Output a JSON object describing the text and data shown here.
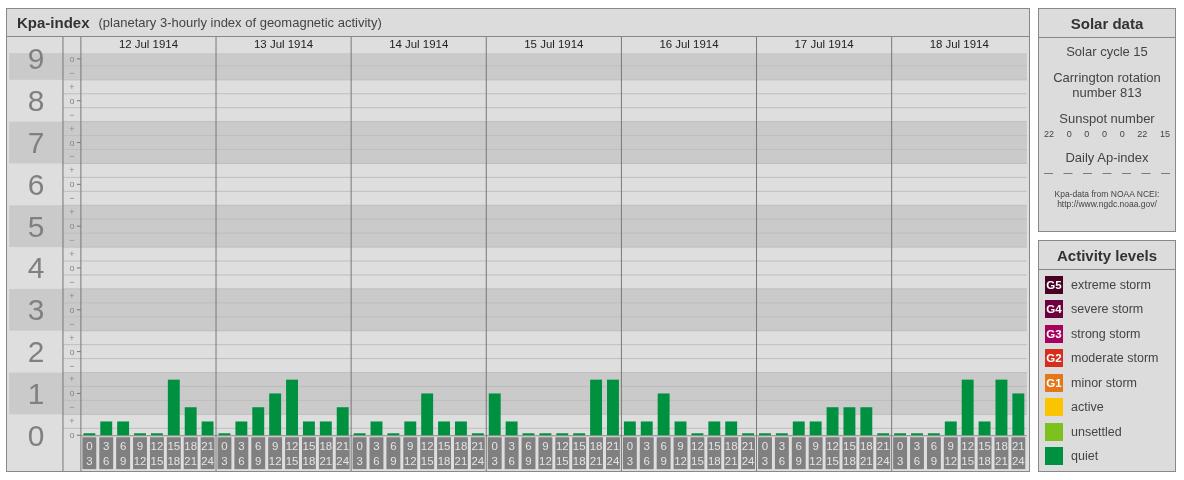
{
  "kp_panel": {
    "title": "Kpa-index",
    "subtitle": "(planetary 3-hourly index of geomagnetic activity)",
    "days": [
      "12 Jul 1914",
      "13 Jul 1914",
      "14 Jul 1914",
      "15 Jul 1914",
      "16 Jul 1914",
      "17 Jul 1914",
      "18 Jul 1914"
    ],
    "chart_data": {
      "type": "bar",
      "categories": [
        "0 3",
        "3 6",
        "6 9",
        "9 12",
        "12 15",
        "15 18",
        "18 21",
        "21 24",
        "0 3",
        "3 6",
        "6 9",
        "9 12",
        "12 15",
        "15 18",
        "18 21",
        "21 24",
        "0 3",
        "3 6",
        "6 9",
        "9 12",
        "12 15",
        "15 18",
        "18 21",
        "21 24",
        "0 3",
        "3 6",
        "6 9",
        "9 12",
        "12 15",
        "15 18",
        "18 21",
        "21 24",
        "0 3",
        "3 6",
        "6 9",
        "9 12",
        "12 15",
        "15 18",
        "18 21",
        "21 24",
        "0 3",
        "3 6",
        "6 9",
        "9 12",
        "12 15",
        "15 18",
        "18 21",
        "21 24",
        "0 3",
        "3 6",
        "6 9",
        "9 12",
        "12 15",
        "15 18",
        "18 21",
        "21 24"
      ],
      "series": [
        {
          "color": "#009140",
          "values": [
            0,
            0.33,
            0.33,
            0,
            0,
            1.33,
            0.67,
            0.33,
            0,
            0.33,
            0.67,
            1,
            1.33,
            0.33,
            0.33,
            0.67,
            0,
            0.33,
            0,
            0.33,
            1,
            0.33,
            0.33,
            0,
            1,
            0.33,
            0,
            0,
            0,
            0,
            1.33,
            1.33,
            0.33,
            0.33,
            1,
            0.33,
            0,
            0.33,
            0.33,
            0,
            0,
            0,
            0.33,
            0.33,
            0.67,
            0.67,
            0.67,
            0,
            0,
            0,
            0,
            0.33,
            1.33,
            0.33,
            1.33,
            1
          ]
        }
      ],
      "ylim": [
        0,
        9.14
      ],
      "yticks": [
        {
          "value": 0,
          "label": "0"
        },
        {
          "value": 1,
          "label": "1"
        },
        {
          "value": 2,
          "label": "2"
        },
        {
          "value": 3,
          "label": "3"
        },
        {
          "value": 4,
          "label": "4"
        },
        {
          "value": 5,
          "label": "5"
        },
        {
          "value": 6,
          "label": "6"
        },
        {
          "value": 7,
          "label": "7"
        },
        {
          "value": 8,
          "label": "8"
        },
        {
          "value": 9,
          "label": "9"
        }
      ],
      "grid": true
    },
    "sublevel_marks": [
      "o",
      "−",
      "+",
      "o",
      "−",
      "+",
      "o",
      "−",
      "+",
      "o",
      "−",
      "+",
      "o",
      "−",
      "+",
      "o",
      "−",
      "+",
      "o",
      "−",
      "+",
      "o",
      "−",
      "+",
      "o",
      "−",
      "+",
      "o"
    ]
  },
  "solar_data": {
    "title": "Solar data",
    "solar_cycle": "Solar cycle 15",
    "carrington": "Carrington rotation number 813",
    "sunspot_heading": "Sunspot number",
    "sunspot_numbers": [
      "22",
      "0",
      "0",
      "0",
      "0",
      "22",
      "15"
    ],
    "ap_heading": "Daily Ap-index",
    "ap_values": [
      "—",
      "—",
      "—",
      "—",
      "—",
      "—",
      "—"
    ],
    "source": [
      "Kpa-data from NOAA NCEI:",
      "http://www.ngdc.noaa.gov/"
    ]
  },
  "activity_levels": {
    "title": "Activity levels",
    "levels": [
      {
        "badge": "G5",
        "label": "extreme storm",
        "color": "#4a0025"
      },
      {
        "badge": "G4",
        "label": "severe storm",
        "color": "#6e0040"
      },
      {
        "badge": "G3",
        "label": "strong storm",
        "color": "#a8005e"
      },
      {
        "badge": "G2",
        "label": "moderate storm",
        "color": "#d62d1c"
      },
      {
        "badge": "G1",
        "label": "minor storm",
        "color": "#e3771a"
      },
      {
        "label": "active",
        "color": "#fbc400"
      },
      {
        "label": "unsettled",
        "color": "#7dc11f"
      },
      {
        "label": "quiet",
        "color": "#009140"
      }
    ]
  }
}
